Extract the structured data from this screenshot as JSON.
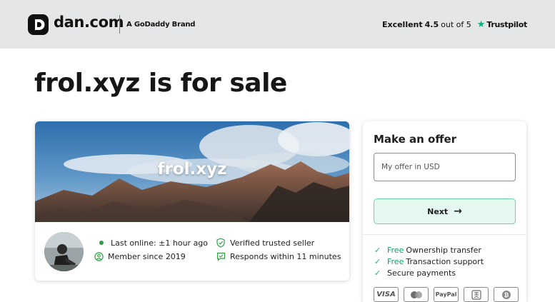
{
  "header": {
    "logo_text": "dan.com",
    "brand_note": "A GoDaddy Brand",
    "rating": {
      "label": "Excellent",
      "score": "4.5",
      "out_of": "out of 5",
      "provider": "Trustpilot"
    }
  },
  "headline": {
    "domain": "frol.xyz",
    "suffix": "is for sale"
  },
  "hero": {
    "domain": "frol.xyz"
  },
  "seller": {
    "last_online": "Last online: ±1 hour ago",
    "member_since": "Member since 2019",
    "verified": "Verified trusted seller",
    "responds": "Responds within 11 minutes"
  },
  "offer": {
    "title": "Make an offer",
    "input_placeholder": "My offer in USD",
    "input_value": "",
    "next_label": "Next",
    "features": [
      {
        "free": "Free",
        "label": "Ownership transfer"
      },
      {
        "free": "Free",
        "label": "Transaction support"
      },
      {
        "free": "",
        "label": "Secure payments"
      }
    ],
    "payment_methods": [
      "VISA",
      "mastercard-icon",
      "PayPal",
      "alipay-icon",
      "bitcoin-icon"
    ]
  },
  "colors": {
    "topbar_bg": "#e5e6e8",
    "accent_green": "#14a06a",
    "button_bg": "#e4f8ef",
    "button_border": "#67d4aa",
    "trustpilot_star": "#00b67a"
  }
}
